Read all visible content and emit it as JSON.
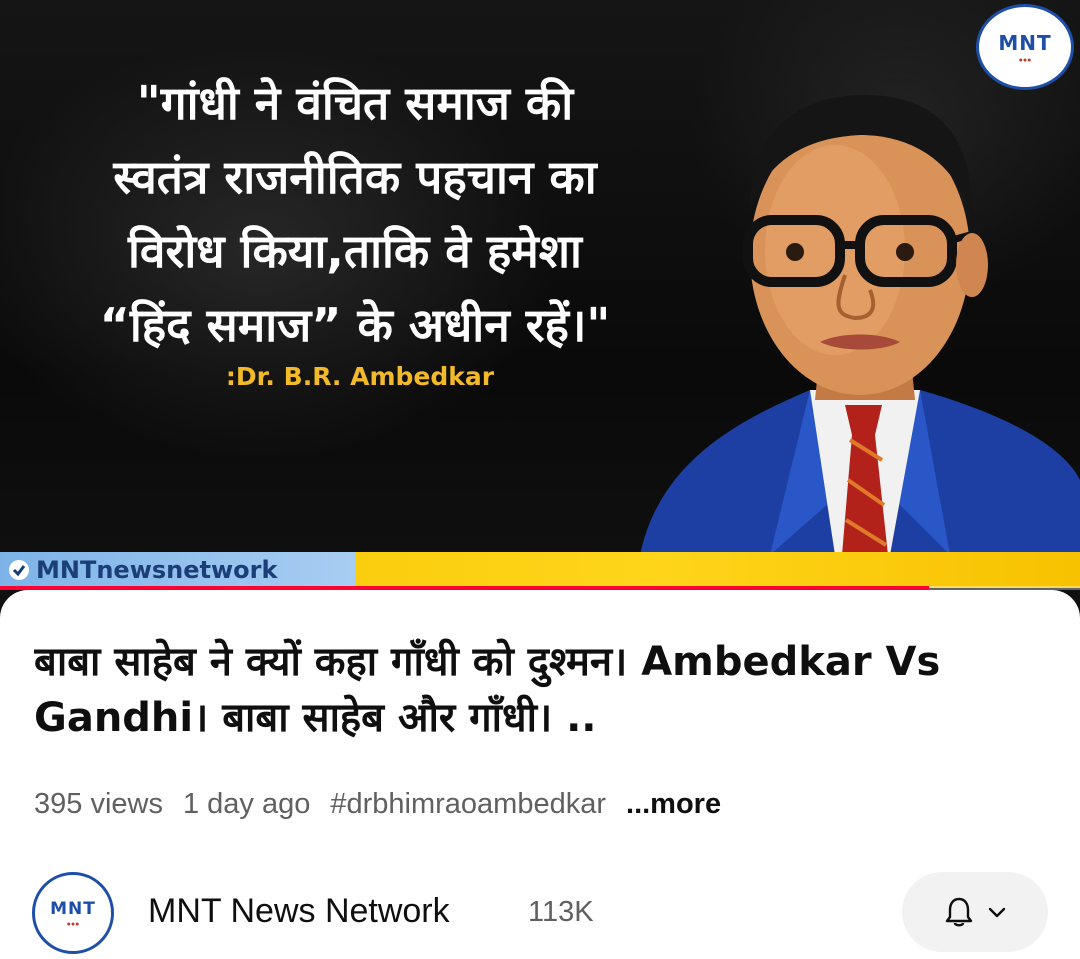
{
  "thumbnail": {
    "quote_lines": [
      "\"गांधी ने वंचित समाज की",
      "स्वतंत्र राजनीतिक पहचान का",
      "विरोध किया,ताकि वे हमेशा",
      "“हिंद समाज” के अधीन रहें।\""
    ],
    "quote_author": ":Dr. B.R. Ambedkar",
    "logo_text": "MNT",
    "ticker_handle": "MNTnewsnetwork"
  },
  "player": {
    "progress_fraction": 0.86
  },
  "video": {
    "title": "बाबा साहेब ने क्यों कहा गाँधी को दुश्मन। Ambedkar Vs Gandhi। बाबा साहेब और गाँधी। ..",
    "views": "395 views",
    "age": "1 day ago",
    "hashtag": "#drbhimraoambedkar",
    "more_label": "...more"
  },
  "channel": {
    "name": "MNT News Network",
    "subscribers": "113K",
    "avatar_text": "MNT"
  },
  "icons": {
    "subscribe": "bell-icon",
    "dropdown": "chevron-down-icon"
  },
  "colors": {
    "accent": "#ff0033",
    "quote_author": "#f2b928",
    "ticker": "#f5c400"
  }
}
